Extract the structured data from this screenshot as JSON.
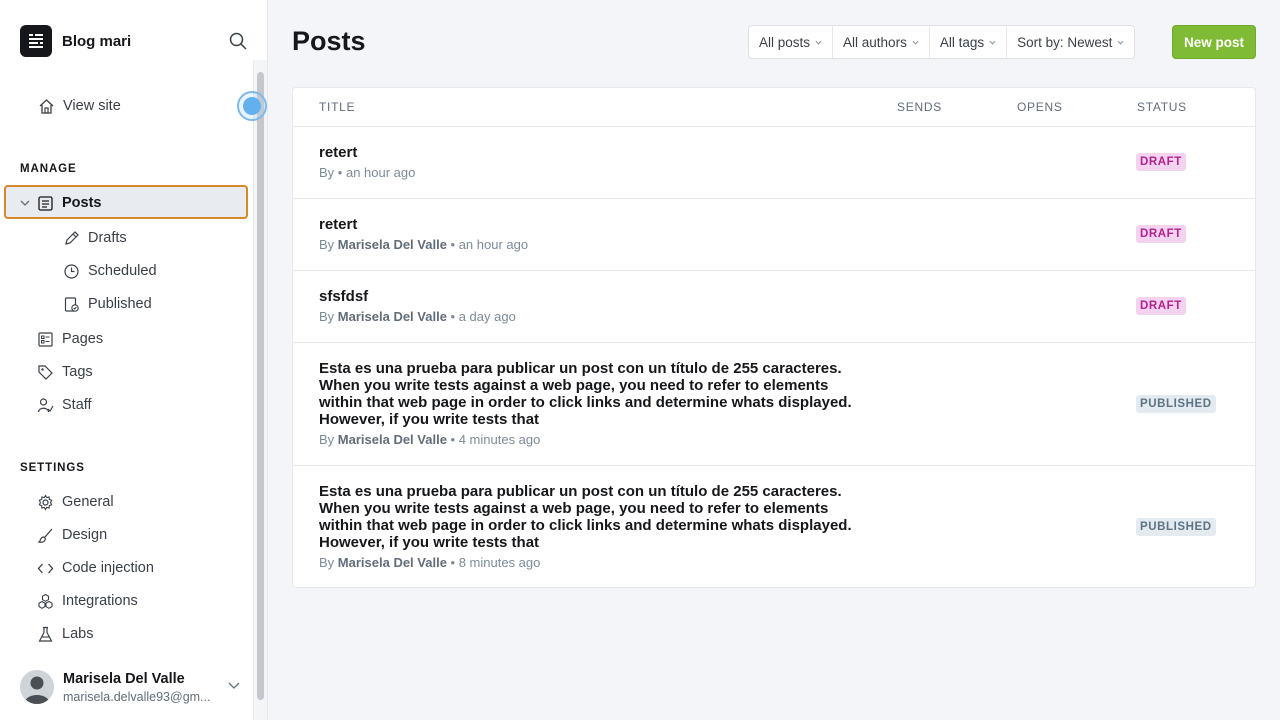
{
  "sidebar": {
    "blog_name": "Blog mari",
    "view_site": "View site",
    "manage_title": "MANAGE",
    "manage_items": [
      {
        "label": "Posts",
        "icon": "posts-icon"
      },
      {
        "label": "Drafts",
        "icon": "pencil-icon"
      },
      {
        "label": "Scheduled",
        "icon": "clock-icon"
      },
      {
        "label": "Published",
        "icon": "published-icon"
      },
      {
        "label": "Pages",
        "icon": "pages-icon"
      },
      {
        "label": "Tags",
        "icon": "tag-icon"
      },
      {
        "label": "Staff",
        "icon": "staff-icon"
      }
    ],
    "settings_title": "SETTINGS",
    "settings_items": [
      {
        "label": "General",
        "icon": "gear-icon"
      },
      {
        "label": "Design",
        "icon": "brush-icon"
      },
      {
        "label": "Code injection",
        "icon": "code-icon"
      },
      {
        "label": "Integrations",
        "icon": "integrations-icon"
      },
      {
        "label": "Labs",
        "icon": "flask-icon"
      }
    ],
    "user": {
      "name": "Marisela Del Valle",
      "email": "marisela.delvalle93@gm..."
    }
  },
  "header": {
    "title": "Posts",
    "filters": [
      "All posts",
      "All authors",
      "All tags",
      "Sort by: Newest"
    ],
    "new_post": "New post"
  },
  "table": {
    "columns": [
      "TITLE",
      "SENDS",
      "OPENS",
      "STATUS"
    ],
    "rows": [
      {
        "title": "retert",
        "by": "By",
        "author": "",
        "time": "an hour ago",
        "status": "DRAFT"
      },
      {
        "title": "retert",
        "by": "By",
        "author": "Marisela Del Valle",
        "time": "an hour ago",
        "status": "DRAFT"
      },
      {
        "title": "sfsfdsf",
        "by": "By",
        "author": "Marisela Del Valle",
        "time": "a day ago",
        "status": "DRAFT"
      },
      {
        "title": "Esta es una prueba para publicar un post con un título de 255 caracteres. When you write tests against a web page, you need to refer to elements within that web page in order to click links and determine whats displayed. However, if you write tests that",
        "by": "By",
        "author": "Marisela Del Valle",
        "time": "4 minutes ago",
        "status": "PUBLISHED"
      },
      {
        "title": "Esta es una prueba para publicar un post con un título de 255 caracteres. When you write tests against a web page, you need to refer to elements within that web page in order to click links and determine whats displayed. However, if you write tests that",
        "by": "By",
        "author": "Marisela Del Valle",
        "time": "8 minutes ago",
        "status": "PUBLISHED"
      }
    ]
  },
  "colors": {
    "accent": "#7fbb34",
    "draft": "#b0248f",
    "published": "#5d7282",
    "focus": "#d4892a"
  }
}
